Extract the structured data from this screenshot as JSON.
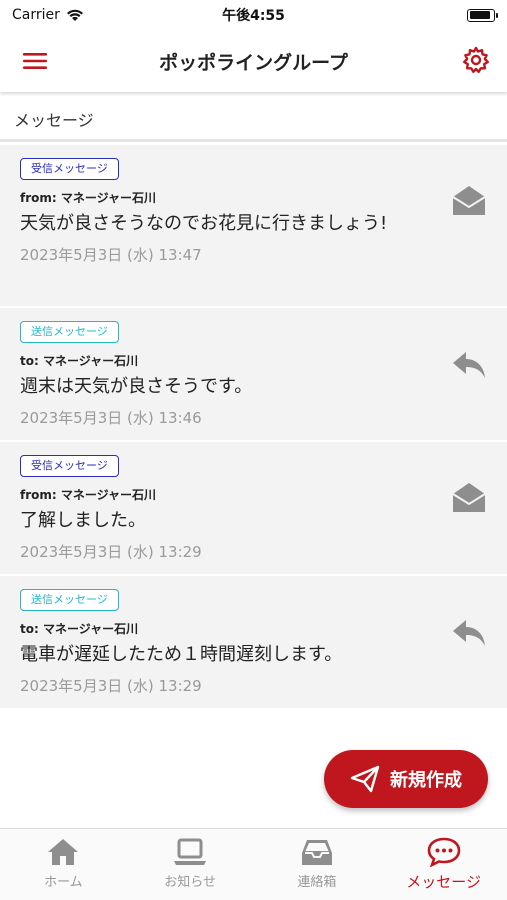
{
  "status_bar": {
    "carrier": "Carrier",
    "time": "午後4:55"
  },
  "nav": {
    "title": "ポッポライングループ"
  },
  "section": {
    "title": "メッセージ"
  },
  "messages": [
    {
      "badge": "受信メッセージ",
      "kind": "received",
      "meta": "from: マネージャー石川",
      "body": "天気が良さそうなのでお花見に行きましょう!",
      "date": "2023年5月3日 (水) 13:47",
      "icon": "envelope-open-icon"
    },
    {
      "badge": "送信メッセージ",
      "kind": "sent",
      "meta": "to: マネージャー石川",
      "body": "週末は天気が良さそうです。",
      "date": "2023年5月3日 (水) 13:46",
      "icon": "reply-icon"
    },
    {
      "badge": "受信メッセージ",
      "kind": "received",
      "meta": "from: マネージャー石川",
      "body": "了解しました。",
      "date": "2023年5月3日 (水) 13:29",
      "icon": "envelope-open-icon"
    },
    {
      "badge": "送信メッセージ",
      "kind": "sent",
      "meta": "to: マネージャー石川",
      "body": "電車が遅延したため１時間遅刻します。",
      "date": "2023年5月3日 (水) 13:29",
      "icon": "reply-icon"
    }
  ],
  "fab": {
    "label": "新規作成"
  },
  "tabs": [
    {
      "label": "ホーム",
      "icon": "home-icon"
    },
    {
      "label": "お知らせ",
      "icon": "laptop-icon"
    },
    {
      "label": "連絡箱",
      "icon": "inbox-icon"
    },
    {
      "label": "メッセージ",
      "icon": "chat-bubble-icon",
      "active": true
    }
  ],
  "colors": {
    "accent": "#c0171f",
    "received_badge": "#2b2dbf",
    "sent_badge": "#21b8c9",
    "icon_gray": "#8e8e8e"
  }
}
